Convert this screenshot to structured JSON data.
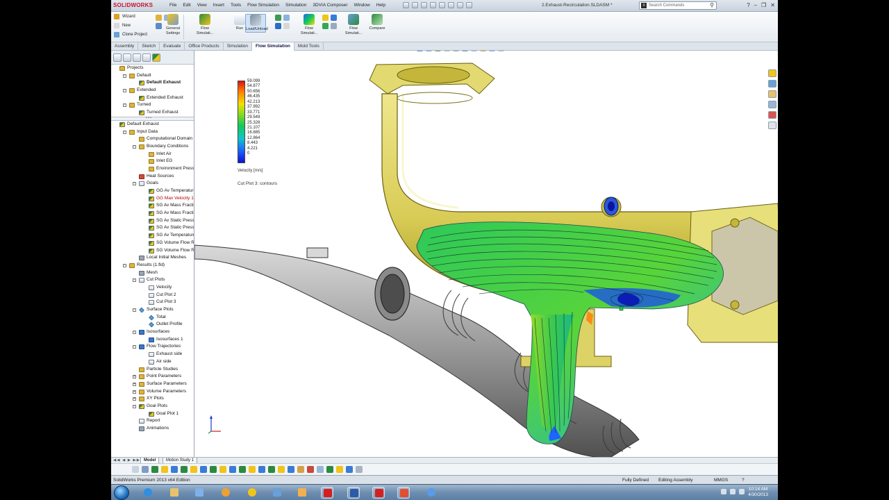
{
  "app": {
    "logo": "SOLIDWORKS",
    "document_title": "2.Exhaust-Recirculation.SLDASM *",
    "menu": [
      "File",
      "Edit",
      "View",
      "Insert",
      "Tools",
      "Flow Simulation",
      "Simulation",
      "3DVIA Composer",
      "Window",
      "Help"
    ],
    "search_placeholder": "Search Commands"
  },
  "ribbon": {
    "wizard": "Wizard",
    "new": "New",
    "clone_project": "Clone Project",
    "general_settings": "General Settings",
    "flow_simulation_1": "Flow Simulati...",
    "run": "Run",
    "load_unload": "Load/Unload",
    "flow_simulation_2": "Flow Simulati...",
    "flow_simulation_3": "Flow Simulati...",
    "compare": "Compare"
  },
  "command_tabs": [
    "Assembly",
    "Sketch",
    "Evaluate",
    "Office Products",
    "Simulation",
    "Flow Simulation",
    "Mold Tools"
  ],
  "command_tabs_active": "Flow Simulation",
  "projects_tree": [
    {
      "label": "Projects",
      "indent": 0,
      "icon": "fold",
      "expander": ""
    },
    {
      "label": "Default",
      "indent": 1,
      "icon": "fold",
      "expander": "-"
    },
    {
      "label": "Default Exhaust",
      "indent": 2,
      "icon": "flow",
      "expander": "",
      "bold": true
    },
    {
      "label": "Extended",
      "indent": 1,
      "icon": "fold",
      "expander": "-"
    },
    {
      "label": "Extended Exhaust",
      "indent": 2,
      "icon": "flow",
      "expander": ""
    },
    {
      "label": "Turned",
      "indent": 1,
      "icon": "fold",
      "expander": "-"
    },
    {
      "label": "Turned Exhaust",
      "indent": 2,
      "icon": "flow",
      "expander": ""
    }
  ],
  "analysis_tree": [
    {
      "label": "Default Exhaust",
      "indent": 0,
      "icon": "flow",
      "expander": ""
    },
    {
      "label": "Input Data",
      "indent": 1,
      "icon": "fold",
      "expander": "-"
    },
    {
      "label": "Computational Domain",
      "indent": 2,
      "icon": "fold",
      "expander": ""
    },
    {
      "label": "Boundary Conditions",
      "indent": 2,
      "icon": "fold",
      "expander": "-"
    },
    {
      "label": "Inlet Air",
      "indent": 3,
      "icon": "fold",
      "expander": ""
    },
    {
      "label": "Inlet EG",
      "indent": 3,
      "icon": "fold",
      "expander": ""
    },
    {
      "label": "Environment Pressu",
      "indent": 3,
      "icon": "fold",
      "expander": ""
    },
    {
      "label": "Heat Sources",
      "indent": 2,
      "icon": "red",
      "expander": ""
    },
    {
      "label": "Goals",
      "indent": 2,
      "icon": "plot",
      "expander": "-"
    },
    {
      "label": "GG Av Temperature",
      "indent": 3,
      "icon": "flow",
      "expander": ""
    },
    {
      "label": "GG Max Velocity 1",
      "indent": 3,
      "icon": "flow",
      "expander": "",
      "red": true
    },
    {
      "label": "SG Av Mass Fraction",
      "indent": 3,
      "icon": "flow",
      "expander": ""
    },
    {
      "label": "SG Av Mass Fraction",
      "indent": 3,
      "icon": "flow",
      "expander": ""
    },
    {
      "label": "SG Av Static Pressur",
      "indent": 3,
      "icon": "flow",
      "expander": ""
    },
    {
      "label": "SG Av Static Pressur",
      "indent": 3,
      "icon": "flow",
      "expander": ""
    },
    {
      "label": "SG Av Temperature",
      "indent": 3,
      "icon": "flow",
      "expander": ""
    },
    {
      "label": "SG Volume Flow Ra",
      "indent": 3,
      "icon": "flow",
      "expander": ""
    },
    {
      "label": "SG Volume Flow Ra",
      "indent": 3,
      "icon": "flow",
      "expander": ""
    },
    {
      "label": "Local Initial Meshes",
      "indent": 2,
      "icon": "grey",
      "expander": ""
    },
    {
      "label": "Results (1.fld)",
      "indent": 1,
      "icon": "fold",
      "expander": "-"
    },
    {
      "label": "Mesh",
      "indent": 2,
      "icon": "grey",
      "expander": ""
    },
    {
      "label": "Cut Plots",
      "indent": 2,
      "icon": "plot",
      "expander": "-"
    },
    {
      "label": "Velocity",
      "indent": 3,
      "icon": "plot",
      "expander": ""
    },
    {
      "label": "Cut Plot 2",
      "indent": 3,
      "icon": "plot",
      "expander": ""
    },
    {
      "label": "Cut Plot 3",
      "indent": 3,
      "icon": "plot",
      "expander": ""
    },
    {
      "label": "Surface Plots",
      "indent": 2,
      "icon": "diam",
      "expander": "-"
    },
    {
      "label": "Total",
      "indent": 3,
      "icon": "diam",
      "expander": ""
    },
    {
      "label": "Outlet Profile",
      "indent": 3,
      "icon": "diam",
      "expander": ""
    },
    {
      "label": "Isosurfaces",
      "indent": 2,
      "icon": "blue",
      "expander": "-"
    },
    {
      "label": "Isosurfaces 1",
      "indent": 3,
      "icon": "blue",
      "expander": ""
    },
    {
      "label": "Flow Trajectories",
      "indent": 2,
      "icon": "blue",
      "expander": "-"
    },
    {
      "label": "Exhaust side",
      "indent": 3,
      "icon": "plot",
      "expander": ""
    },
    {
      "label": "Air side",
      "indent": 3,
      "icon": "plot",
      "expander": ""
    },
    {
      "label": "Particle Studies",
      "indent": 2,
      "icon": "fold",
      "expander": ""
    },
    {
      "label": "Point Parameters",
      "indent": 2,
      "icon": "fold",
      "expander": "+"
    },
    {
      "label": "Surface Parameters",
      "indent": 2,
      "icon": "fold",
      "expander": "+"
    },
    {
      "label": "Volume Parameters",
      "indent": 2,
      "icon": "fold",
      "expander": "+"
    },
    {
      "label": "XY Plots",
      "indent": 2,
      "icon": "fold",
      "expander": "+"
    },
    {
      "label": "Goal Plots",
      "indent": 2,
      "icon": "flow",
      "expander": "-"
    },
    {
      "label": "Goal Plot 1",
      "indent": 3,
      "icon": "flow",
      "expander": ""
    },
    {
      "label": "Report",
      "indent": 2,
      "icon": "plot",
      "expander": ""
    },
    {
      "label": "Animations",
      "indent": 2,
      "icon": "grey",
      "expander": ""
    }
  ],
  "legend": {
    "ticks": [
      "59.099",
      "54.877",
      "50.656",
      "46.435",
      "42.213",
      "37.992",
      "33.771",
      "29.549",
      "25.328",
      "21.107",
      "16.885",
      "12.864",
      "8.443",
      "4.221",
      "0"
    ],
    "unit": "Velocity [m/s]",
    "plot_name": "Cut Plot 3: contours"
  },
  "bottom_tabs": [
    "Model",
    "Motion Study 1"
  ],
  "bottom_tab_active": "Model",
  "status": {
    "edition": "SolidWorks Premium 2013 x64 Edition",
    "definition": "Fully Defined",
    "mode": "Editing Assembly",
    "units": "MMGS"
  },
  "taskbar": {
    "time": "10:14 AM",
    "date": "4/30/2013"
  },
  "colors": {
    "part_yellow": "#ded45a",
    "part_grey": "#9a9a9a",
    "accent": "#c8102e"
  }
}
